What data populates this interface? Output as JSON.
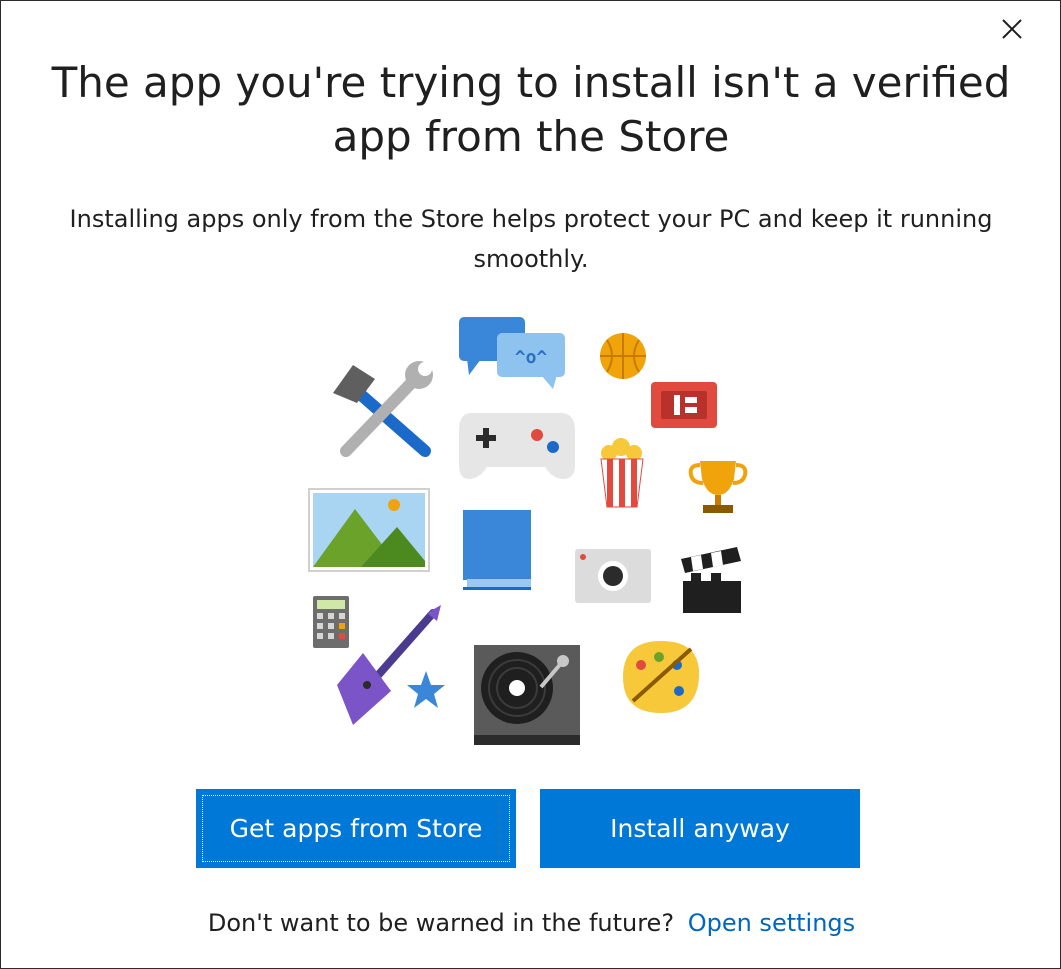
{
  "dialog": {
    "title": "The app you're trying to install isn't a verified app from the Store",
    "subtitle": "Installing apps only from the Store helps protect your PC and keep it running smoothly.",
    "chat_bubble_text": "^o^",
    "buttons": {
      "primary_label": "Get apps from Store",
      "secondary_label": "Install anyway"
    },
    "footer": {
      "question": "Don't want to be warned in the future?",
      "link_label": "Open settings"
    }
  },
  "colors": {
    "accent": "#0078d7",
    "link": "#0067c0"
  },
  "icons": [
    "close-icon",
    "chat-icon",
    "basketball-icon",
    "ticket-icon",
    "hammer-wrench-icon",
    "gamepad-icon",
    "popcorn-icon",
    "trophy-icon",
    "photo-icon",
    "book-icon",
    "camera-icon",
    "clapperboard-icon",
    "calculator-icon",
    "guitar-icon",
    "star-icon",
    "turntable-icon",
    "paint-palette-icon"
  ]
}
